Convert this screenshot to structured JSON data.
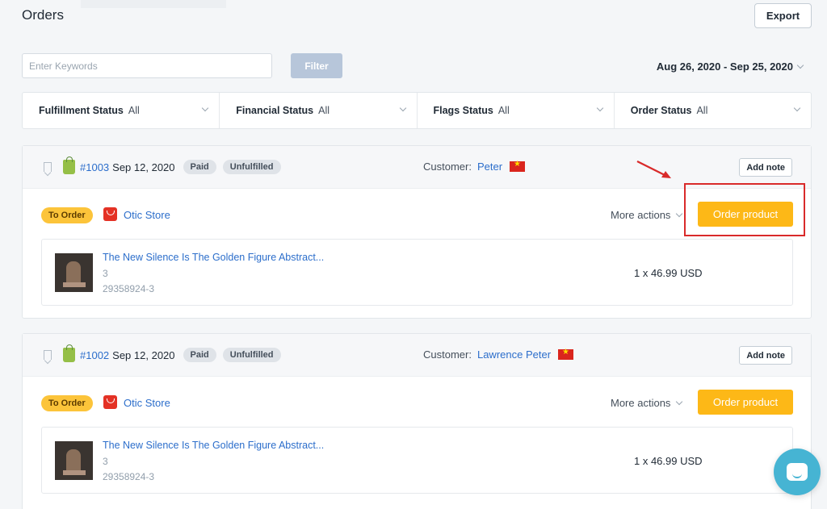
{
  "page": {
    "title": "Orders",
    "export_label": "Export"
  },
  "search": {
    "placeholder": "Enter Keywords",
    "filter_label": "Filter"
  },
  "date_range": "Aug 26, 2020 - Sep 25, 2020",
  "filters": [
    {
      "label": "Fulfillment Status",
      "value": "All"
    },
    {
      "label": "Financial Status",
      "value": "All"
    },
    {
      "label": "Flags Status",
      "value": "All"
    },
    {
      "label": "Order Status",
      "value": "All"
    }
  ],
  "orders": [
    {
      "number": "#1003",
      "date": "Sep 12, 2020",
      "payment_badge": "Paid",
      "fulfillment_badge": "Unfulfilled",
      "customer_label": "Customer:",
      "customer_name": "Peter",
      "add_note_label": "Add note",
      "status_badge": "To Order",
      "store_name": "Otic Store",
      "more_actions_label": "More actions",
      "order_button_label": "Order product",
      "item": {
        "title": "The New Silence Is The Golden Figure Abstract...",
        "variant": "3",
        "sku": "29358924-3",
        "price": "1 x 46.99 USD"
      }
    },
    {
      "number": "#1002",
      "date": "Sep 12, 2020",
      "payment_badge": "Paid",
      "fulfillment_badge": "Unfulfilled",
      "customer_label": "Customer:",
      "customer_name": "Lawrence Peter",
      "add_note_label": "Add note",
      "status_badge": "To Order",
      "store_name": "Otic Store",
      "more_actions_label": "More actions",
      "order_button_label": "Order product",
      "item": {
        "title": "The New Silence Is The Golden Figure Abstract...",
        "variant": "3",
        "sku": "29358924-3",
        "price": "1 x 46.99 USD"
      }
    }
  ],
  "colors": {
    "accent_blue": "#2c6ecb",
    "order_button": "#fdb817",
    "to_order_badge": "#fcc43a",
    "highlight_red": "#d92a2a",
    "chat_button": "#46b4d3"
  },
  "icons": {
    "bookmark": "bookmark-icon",
    "shop": "shopify-icon",
    "flag": "vietnam-flag-icon",
    "store": "aliexpress-store-icon",
    "chat": "chat-icon"
  }
}
